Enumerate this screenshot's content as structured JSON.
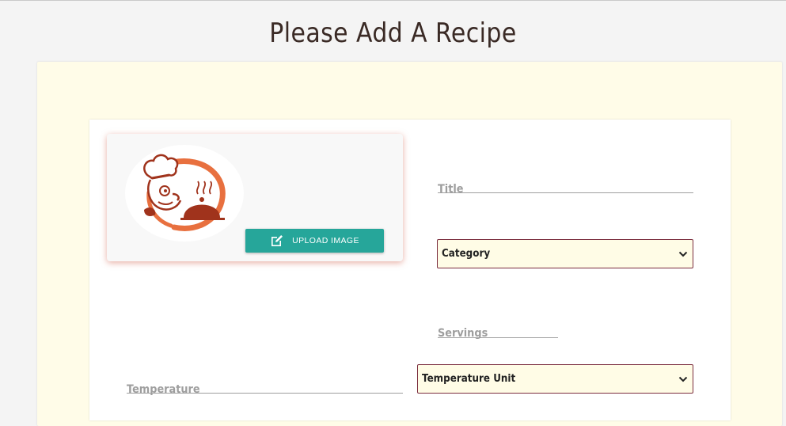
{
  "page": {
    "title": "Please Add A Recipe"
  },
  "image_card": {
    "upload_label": "UPLOAD IMAGE"
  },
  "fields": {
    "title_label": "Title",
    "category_value": "Category",
    "servings_label": "Servings",
    "temperature_label": "Temperature",
    "temperature_unit_value": "Temperature Unit"
  },
  "icons": {
    "upload": "edit-square-icon",
    "dropdown": "chevron-down-icon",
    "logo": "chef-logo-icon"
  },
  "colors": {
    "accent_teal": "#26a69a",
    "select_border": "#7b2d3e",
    "select_bg": "#fffce6",
    "outer_bg": "#fffce8",
    "logo_brown": "#a0331c",
    "logo_orange": "#e8703f"
  }
}
